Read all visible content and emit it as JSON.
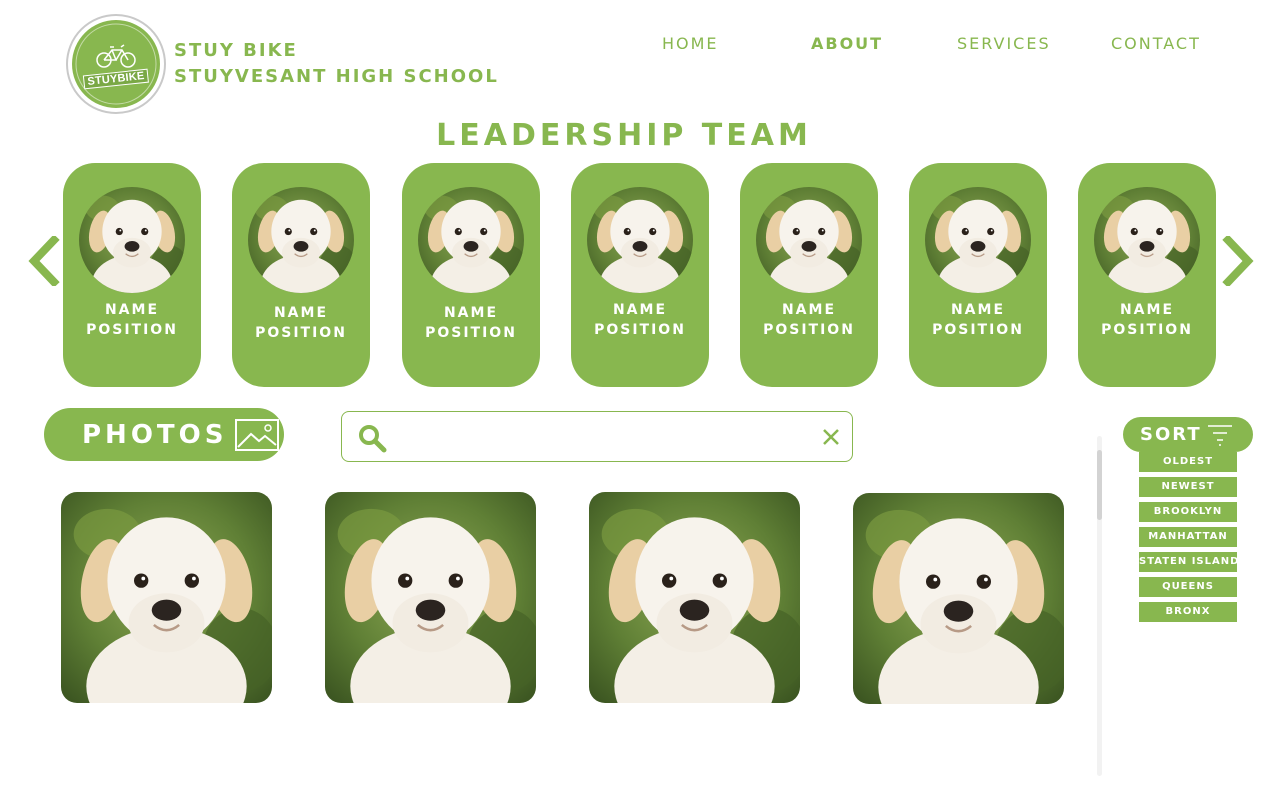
{
  "brand": {
    "logo_text": "STUYBIKE",
    "line1": "STUY BIKE",
    "line2": "STUYVESANT HIGH SCHOOL"
  },
  "nav": {
    "items": [
      {
        "label": "HOME",
        "active": false
      },
      {
        "label": "ABOUT",
        "active": true
      },
      {
        "label": "SERVICES",
        "active": false
      },
      {
        "label": "CONTACT",
        "active": false
      }
    ]
  },
  "leadership": {
    "title": "LEADERSHIP TEAM",
    "members": [
      {
        "name": "NAME",
        "position": "POSITION"
      },
      {
        "name": "NAME",
        "position": "POSITION"
      },
      {
        "name": "NAME",
        "position": "POSITION"
      },
      {
        "name": "NAME",
        "position": "POSITION"
      },
      {
        "name": "NAME",
        "position": "POSITION"
      },
      {
        "name": "NAME",
        "position": "POSITION"
      },
      {
        "name": "NAME",
        "position": "POSITION"
      }
    ],
    "prev_icon": "chevron-left-icon",
    "next_icon": "chevron-right-icon"
  },
  "photos": {
    "label": "PHOTOS",
    "icon": "image-icon",
    "count_shown": 4
  },
  "search": {
    "value": "",
    "placeholder": "",
    "icon": "search-icon",
    "clear_icon": "close-icon"
  },
  "sort": {
    "label": "SORT",
    "icon": "filter-icon",
    "options": [
      "OLDEST",
      "NEWEST",
      "BROOKLYN",
      "MANHATTAN",
      "STATEN ISLAND",
      "QUEENS",
      "BRONX"
    ]
  },
  "colors": {
    "accent": "#88b74f",
    "white": "#ffffff"
  }
}
